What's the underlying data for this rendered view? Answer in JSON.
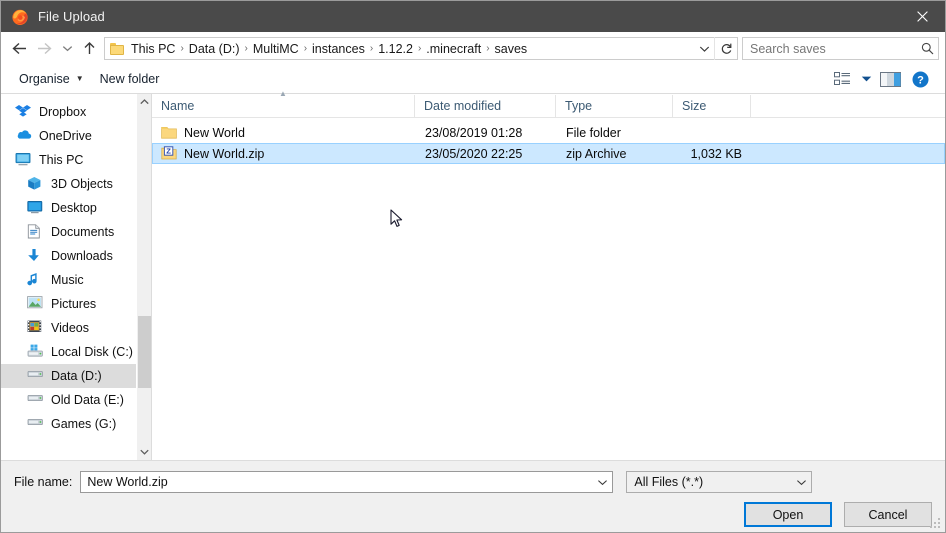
{
  "window": {
    "title": "File Upload",
    "app_icon": "firefox-icon",
    "close_label": "✕"
  },
  "nav": {
    "back_icon": "arrow-left-icon",
    "forward_icon": "arrow-right-icon",
    "recent_icon": "chevron-down-icon",
    "up_icon": "arrow-up-icon",
    "refresh_icon": "refresh-icon",
    "dropdown_icon": "chevron-down-icon",
    "breadcrumbs": [
      "This PC",
      "Data (D:)",
      "MultiMC",
      "instances",
      "1.12.2",
      ".minecraft",
      "saves"
    ],
    "separator": "›"
  },
  "search": {
    "placeholder": "Search saves",
    "value": "",
    "icon": "search-icon"
  },
  "toolbar": {
    "organise_label": "Organise",
    "organise_caret": "▼",
    "new_folder_label": "New folder",
    "view_icon": "list-view-icon",
    "view_caret": "▼",
    "pane_icon": "preview-pane-icon",
    "help_icon": "help-icon"
  },
  "sidebar": {
    "items": [
      {
        "label": "Dropbox",
        "icon": "dropbox-icon",
        "level": 0,
        "selected": false
      },
      {
        "label": "OneDrive",
        "icon": "onedrive-cloud-icon",
        "level": 0,
        "selected": false
      },
      {
        "label": "This PC",
        "icon": "this-pc-icon",
        "level": 0,
        "selected": false
      },
      {
        "label": "3D Objects",
        "icon": "3d-objects-icon",
        "level": 1,
        "selected": false
      },
      {
        "label": "Desktop",
        "icon": "desktop-icon",
        "level": 1,
        "selected": false
      },
      {
        "label": "Documents",
        "icon": "documents-icon",
        "level": 1,
        "selected": false
      },
      {
        "label": "Downloads",
        "icon": "downloads-icon",
        "level": 1,
        "selected": false
      },
      {
        "label": "Music",
        "icon": "music-note-icon",
        "level": 1,
        "selected": false
      },
      {
        "label": "Pictures",
        "icon": "pictures-icon",
        "level": 1,
        "selected": false
      },
      {
        "label": "Videos",
        "icon": "videos-icon",
        "level": 1,
        "selected": false
      },
      {
        "label": "Local Disk (C:)",
        "icon": "system-drive-icon",
        "level": 1,
        "selected": false
      },
      {
        "label": "Data (D:)",
        "icon": "drive-icon",
        "level": 1,
        "selected": true
      },
      {
        "label": "Old Data (E:)",
        "icon": "drive-icon",
        "level": 1,
        "selected": false
      },
      {
        "label": "Games (G:)",
        "icon": "drive-icon",
        "level": 1,
        "selected": false
      }
    ],
    "scroll_up_icon": "chevron-up-icon",
    "scroll_down_icon": "chevron-down-icon"
  },
  "filelist": {
    "columns": [
      {
        "key": "name",
        "label": "Name",
        "sorted": true,
        "sort_dir": "asc"
      },
      {
        "key": "date",
        "label": "Date modified"
      },
      {
        "key": "type",
        "label": "Type"
      },
      {
        "key": "size",
        "label": "Size"
      }
    ],
    "sort_caret": "▲",
    "rows": [
      {
        "name": "New World",
        "date": "23/08/2019 01:28",
        "type": "File folder",
        "size": "",
        "icon": "folder-icon",
        "selected": false
      },
      {
        "name": "New World.zip",
        "date": "23/05/2020 22:25",
        "type": "zip Archive",
        "size": "1,032 KB",
        "icon": "zip-archive-icon",
        "selected": true
      }
    ]
  },
  "footer": {
    "filename_label": "File name:",
    "filename_value": "New World.zip",
    "filename_caret": "⌄",
    "filetype_value": "All Files (*.*)",
    "filetype_caret": "⌄",
    "open_label": "Open",
    "cancel_label": "Cancel"
  },
  "colors": {
    "titlebar": "#4a4a4a",
    "selection": "#cce8ff",
    "selection_border": "#99d1ff",
    "focus_blue": "#0078d7",
    "header_text": "#3c5a73",
    "sidebar_selected": "#dcdcdc"
  }
}
